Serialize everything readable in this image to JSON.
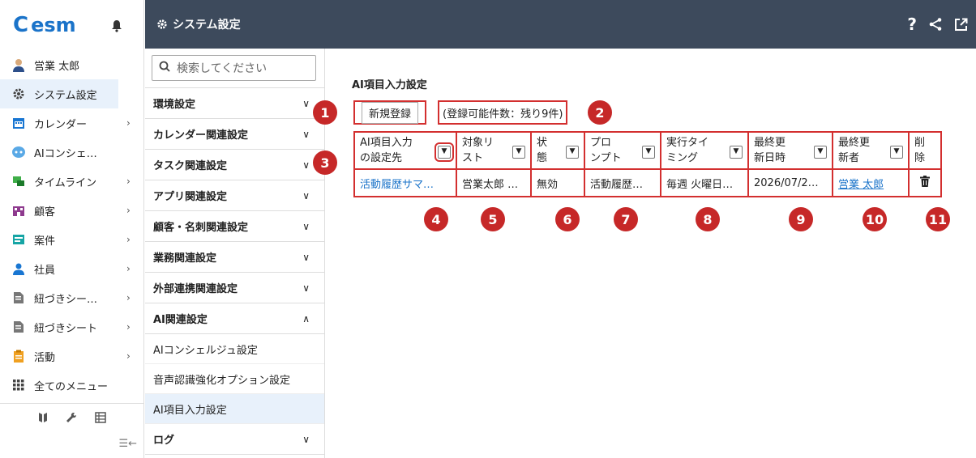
{
  "app": {
    "logo_text": "esm",
    "logo_e": "C"
  },
  "user": {
    "name": "営業 太郎"
  },
  "nav": {
    "items": [
      {
        "label": "システム設定",
        "icon": "gear-icon",
        "active": true,
        "arrow": ""
      },
      {
        "label": "カレンダー",
        "icon": "calendar-icon",
        "arrow": "›"
      },
      {
        "label": "AIコンシェ…",
        "icon": "ai-concierge-icon",
        "arrow": ""
      },
      {
        "label": "タイムライン",
        "icon": "timeline-icon",
        "arrow": "›"
      },
      {
        "label": "顧客",
        "icon": "building-icon",
        "arrow": "›"
      },
      {
        "label": "案件",
        "icon": "case-icon",
        "arrow": "›"
      },
      {
        "label": "社員",
        "icon": "person-icon",
        "arrow": "›"
      },
      {
        "label": "紐づきシー…",
        "icon": "sheet-icon",
        "arrow": "›"
      },
      {
        "label": "紐づきシート",
        "icon": "sheet-icon",
        "arrow": "›"
      },
      {
        "label": "活動",
        "icon": "activity-icon",
        "arrow": "›"
      },
      {
        "label": "全てのメニュー",
        "icon": "grid-icon",
        "arrow": ""
      }
    ]
  },
  "topbar": {
    "title": "システム設定",
    "help": "?"
  },
  "settings_menu": {
    "search_placeholder": "検索してください",
    "categories": [
      {
        "label": "環境設定",
        "chev": "∨"
      },
      {
        "label": "カレンダー関連設定",
        "chev": "∨"
      },
      {
        "label": "タスク関連設定",
        "chev": "∨"
      },
      {
        "label": "アプリ関連設定",
        "chev": "∨"
      },
      {
        "label": "顧客・名刺関連設定",
        "chev": "∨"
      },
      {
        "label": "業務関連設定",
        "chev": "∨"
      },
      {
        "label": "外部連携関連設定",
        "chev": "∨"
      },
      {
        "label": "AI関連設定",
        "chev": "∧"
      }
    ],
    "sub_items": [
      "AIコンシェルジュ設定",
      "音声認識強化オプション設定",
      "AI項目入力設定"
    ],
    "last_category": {
      "label": "ログ",
      "chev": "∨"
    }
  },
  "main": {
    "section_title": "AI項目入力設定",
    "new_button": "新規登録",
    "remaining": "(登録可能件数：残り9件)",
    "columns": [
      {
        "line1": "AI項目入力",
        "line2": "の設定先"
      },
      {
        "line1": "対象リ",
        "line2": "スト"
      },
      {
        "line1": "状",
        "line2": "態"
      },
      {
        "line1": "プロ",
        "line2": "ンプト"
      },
      {
        "line1": "実行タイ",
        "line2": "ミング"
      },
      {
        "line1": "最終更",
        "line2": "新日時"
      },
      {
        "line1": "最終更",
        "line2": "新者"
      },
      {
        "line1": "削",
        "line2": "除"
      }
    ],
    "row": {
      "target": "活動履歴サマ…",
      "list": "営業太郎 …",
      "status": "無効",
      "prompt": "活動履歴…",
      "timing": "毎週 火曜日…",
      "updated_at": "2026/07/2…",
      "updated_by": "営業 太郎"
    }
  },
  "badges": [
    "1",
    "2",
    "3",
    "4",
    "5",
    "6",
    "7",
    "8",
    "9",
    "10",
    "11"
  ]
}
